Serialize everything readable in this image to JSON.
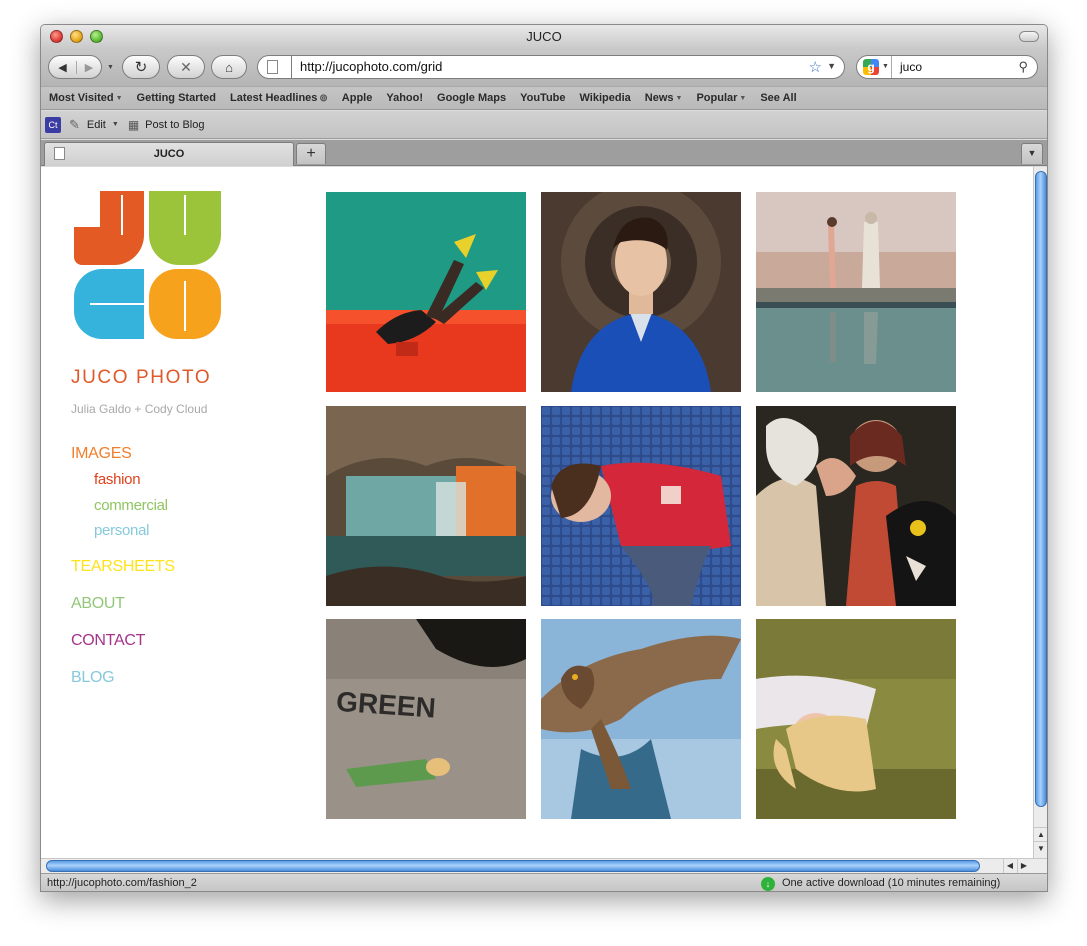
{
  "window": {
    "title": "JUCO"
  },
  "toolbar": {
    "url": "http://jucophoto.com/grid",
    "search_query": "juco"
  },
  "bookmarks": [
    {
      "label": "Most Visited"
    },
    {
      "label": "Getting Started"
    },
    {
      "label": "Latest Headlines"
    },
    {
      "label": "Apple"
    },
    {
      "label": "Yahoo!"
    },
    {
      "label": "Google Maps"
    },
    {
      "label": "YouTube"
    },
    {
      "label": "Wikipedia"
    },
    {
      "label": "News"
    },
    {
      "label": "Popular"
    },
    {
      "label": "See All"
    }
  ],
  "extensions": {
    "logo_text": "Ct",
    "edit_label": "Edit",
    "post_label": "Post to Blog"
  },
  "tab": {
    "label": "JUCO"
  },
  "site": {
    "logo": {
      "letters": [
        "J",
        "U",
        "C",
        "O"
      ],
      "colors": [
        "#e45a24",
        "#9cc43a",
        "#35b3dc",
        "#f6a21d"
      ]
    },
    "title": "JUCO PHOTO",
    "subtitle": "Julia Galdo + Cody Cloud",
    "nav": {
      "images": {
        "label": "IMAGES",
        "color": "#f07f2c"
      },
      "fashion": {
        "label": "fashion",
        "color": "#e0401c"
      },
      "commercial": {
        "label": "commercial",
        "color": "#8ec660"
      },
      "personal": {
        "label": "personal",
        "color": "#86c9dc"
      },
      "tearsheets": {
        "label": "TEARSHEETS",
        "color": "#ffe31a"
      },
      "about": {
        "label": "ABOUT",
        "color": "#92c779"
      },
      "contact": {
        "label": "CONTACT",
        "color": "#a5348b"
      },
      "blog": {
        "label": "BLOG",
        "color": "#86c9dc"
      }
    }
  },
  "status": {
    "link_url": "http://jucophoto.com/fashion_2",
    "download_text": "One active download (10 minutes remaining)"
  }
}
